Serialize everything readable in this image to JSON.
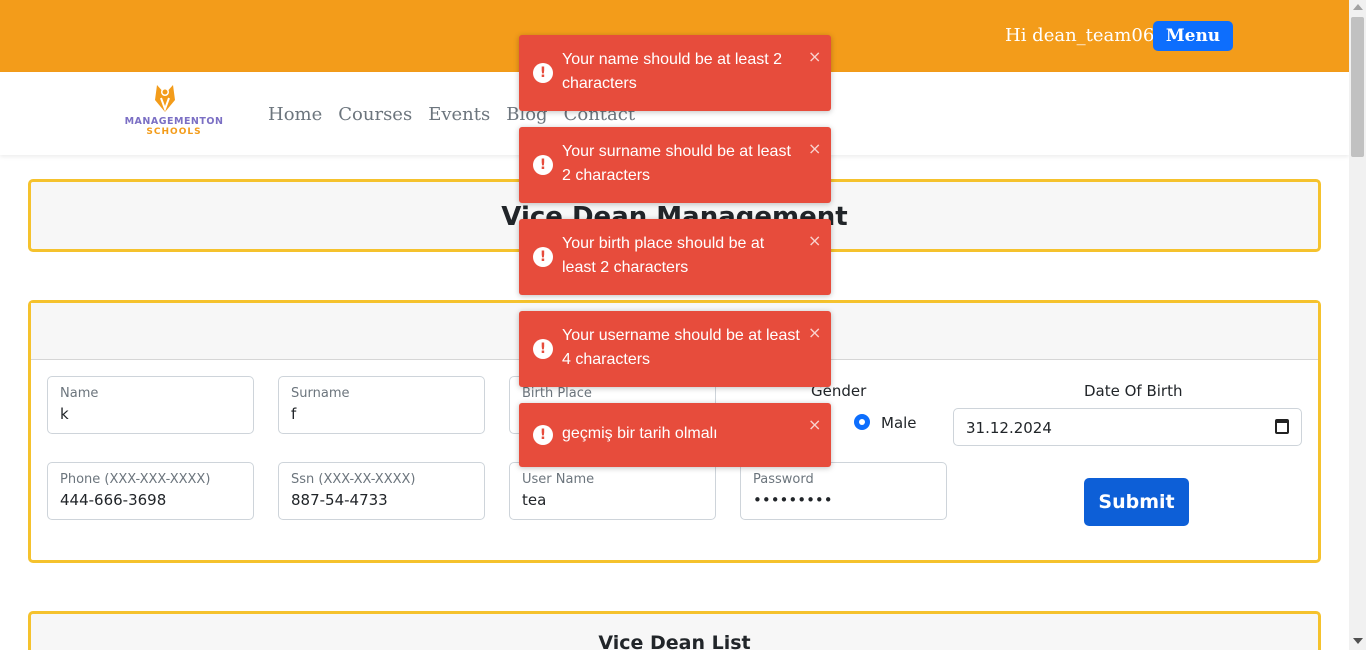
{
  "header": {
    "greeting": "Hi dean_team06",
    "menu_label": "Menu"
  },
  "brand": {
    "name": "MANAGEMENTON",
    "sub": "SCHOOLS"
  },
  "nav": {
    "items": [
      "Home",
      "Courses",
      "Events",
      "Blog",
      "Contact"
    ]
  },
  "page": {
    "title": "Vice Dean Management",
    "list_title": "Vice Dean List"
  },
  "form": {
    "name": {
      "label": "Name",
      "value": "k"
    },
    "surname": {
      "label": "Surname",
      "value": "f"
    },
    "birth_place": {
      "label": "Birth Place",
      "value": ""
    },
    "gender": {
      "label": "Gender",
      "male_label": "Male"
    },
    "dob": {
      "label": "Date Of Birth",
      "value": "31.12.2024"
    },
    "phone": {
      "label": "Phone (XXX-XXX-XXXX)",
      "value": "444-666-3698"
    },
    "ssn": {
      "label": "Ssn (XXX-XX-XXXX)",
      "value": "887-54-4733"
    },
    "username": {
      "label": "User Name",
      "value": "tea"
    },
    "password": {
      "label": "Password",
      "value": "•••••••••"
    },
    "submit_label": "Submit"
  },
  "toasts": [
    "Your name should be at least 2 characters",
    "Your surname should be at least 2 characters",
    "Your birth place should be at least 2 characters",
    "Your username should be at least 4 characters",
    "geçmiş bir tarih olmalı"
  ],
  "toast_close": "×",
  "toast_icon": "!",
  "colors": {
    "topbar": "#f39c1a",
    "card_border": "#f5c22d",
    "primary": "#0d6efd",
    "toast": "#e74c3c"
  }
}
